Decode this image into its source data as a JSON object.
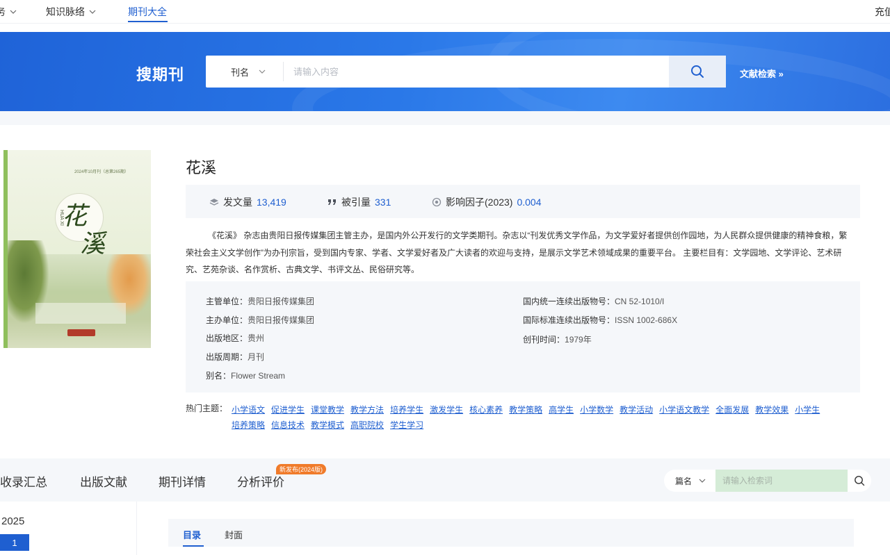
{
  "topnav": {
    "items": [
      {
        "label": "务"
      },
      {
        "label": "知识脉络"
      },
      {
        "label": "期刊大全"
      }
    ],
    "right_label": "充值"
  },
  "banner": {
    "title": "搜期刊",
    "search": {
      "field": "刊名",
      "placeholder": "请输入内容"
    },
    "adv_link": "文献检索 »"
  },
  "journal": {
    "name": "花溪",
    "stats": {
      "articles_label": "发文量",
      "articles_value": "13,419",
      "citations_label": "被引量",
      "citations_value": "331",
      "impact_label": "影响因子(2023)",
      "impact_value": "0.004"
    },
    "description": "《花溪》 杂志由贵阳日报传媒集团主管主办，是国内外公开发行的文学类期刊。杂志以“刊发优秀文学作品，为文学爱好者提供创作园地，为人民群众提供健康的精神食粮，繁荣社会主义文学创作”为办刊宗旨，受到国内专家、学者、文学爱好者及广大读者的欢迎与支持，是展示文学艺术领域成果的重要平台。 主要栏目有：文学园地、文学评论、艺术研究、艺苑杂谈、名作赏析、古典文学、书评文丛、民俗研究等。",
    "info": {
      "supervisor_k": "主管单位：",
      "supervisor_v": "贵阳日报传媒集团",
      "sponsor_k": "主办单位：",
      "sponsor_v": "贵阳日报传媒集团",
      "region_k": "出版地区：",
      "region_v": "贵州",
      "cycle_k": "出版周期：",
      "cycle_v": "月刊",
      "alias_k": "别名：",
      "alias_v": "Flower Stream",
      "cn_k": "国内统一连续出版物号：",
      "cn_v": "CN 52-1010/I",
      "issn_k": "国际标准连续出版物号：",
      "issn_v": "ISSN 1002-686X",
      "founded_k": "创刊时间：",
      "founded_v": "1979年"
    },
    "cover": {
      "issue_line": "2024年10月刊（总第265期）",
      "title_chars": [
        "花",
        "溪"
      ],
      "latin": "HUA XI"
    }
  },
  "hot_topics": {
    "label": "热门主题：",
    "tags": [
      "小学语文",
      "促进学生",
      "课堂教学",
      "教学方法",
      "培养学生",
      "激发学生",
      "核心素养",
      "教学策略",
      "高学生",
      "小学数学",
      "教学活动",
      "小学语文教学",
      "全面发展",
      "教学效果",
      "小学生",
      "培养策略",
      "信息技术",
      "教学模式",
      "高职院校",
      "学生学习"
    ]
  },
  "tabs": {
    "items": [
      "收录汇总",
      "出版文献",
      "期刊详情",
      "分析评价"
    ],
    "new_badge": "新发布(2024版)",
    "search_field": "篇名",
    "search_placeholder": "请输入检索词"
  },
  "sidebar": {
    "year": "2025",
    "issue": "1"
  },
  "subtabs": {
    "items": [
      "目录",
      "封面"
    ]
  },
  "colors": {
    "accent": "#1f5fd0",
    "badge": "#f07b2a"
  }
}
